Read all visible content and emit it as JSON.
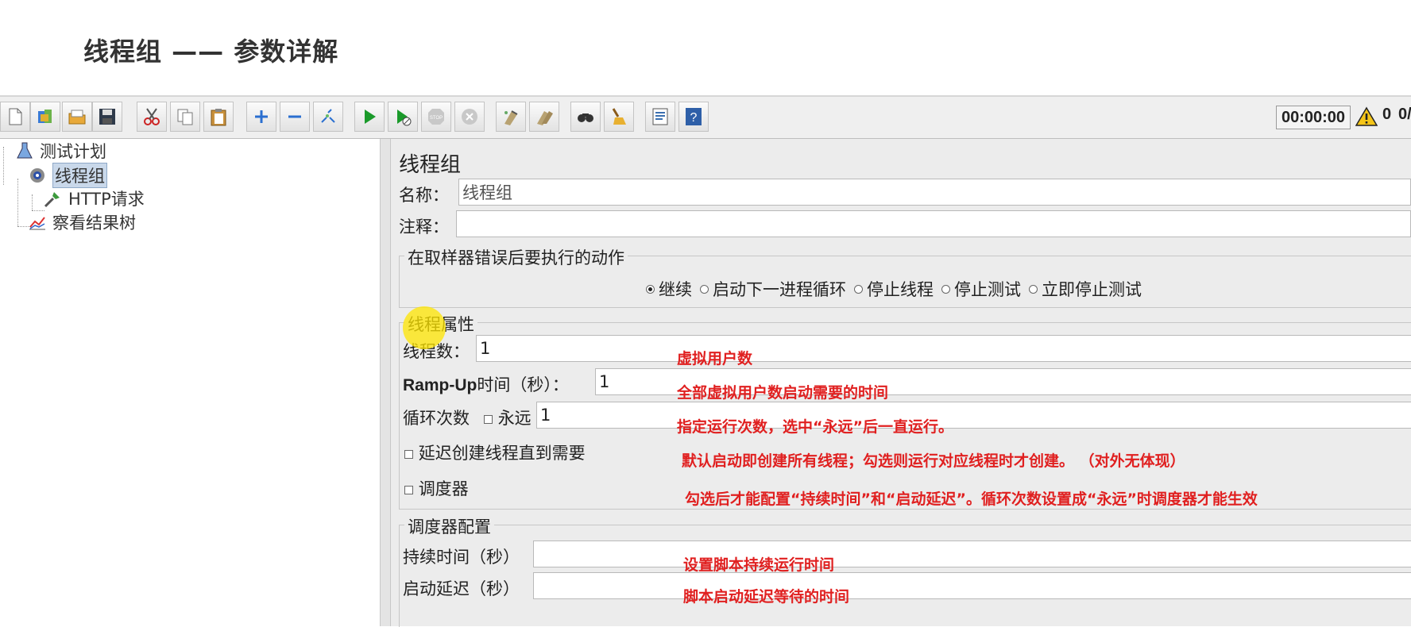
{
  "slide": {
    "title": "线程组 —— 参数详解"
  },
  "toolbar": {
    "buttons": [
      "new-icon",
      "templates-icon",
      "open-icon",
      "save-icon",
      "cut-icon",
      "copy-icon",
      "paste-icon",
      "expand-icon",
      "collapse-icon",
      "toggle-icon",
      "start-icon",
      "start-no-pause-icon",
      "stop-icon",
      "shutdown-icon",
      "clear-icon",
      "clear-all-icon",
      "search-icon",
      "reset-search-icon",
      "function-helper-icon",
      "help-icon"
    ],
    "timer": "00:00:00",
    "warning_count": "0",
    "running_count": "0/"
  },
  "tree": {
    "items": [
      {
        "label": "测试计划",
        "icon": "flask-icon"
      },
      {
        "label": "线程组",
        "icon": "gear-icon",
        "selected": true
      },
      {
        "label": "HTTP请求",
        "icon": "pipette-icon"
      },
      {
        "label": "察看结果树",
        "icon": "chart-icon"
      }
    ]
  },
  "panel": {
    "title": "线程组",
    "name_label": "名称：",
    "name_value": "线程组",
    "comment_label": "注释：",
    "comment_value": "",
    "error_group": {
      "title": "在取样器错误后要执行的动作",
      "options": [
        "继续",
        "启动下一进程循环",
        "停止线程",
        "停止测试",
        "立即停止测试"
      ],
      "selected": "继续"
    },
    "thread_group": {
      "title_part1": "线程",
      "title_part2": "属性",
      "threads_label": "线程数：",
      "threads_value": "1",
      "rampup_label_bold": "Ramp-Up",
      "rampup_label_rest": "时间（秒）：",
      "rampup_value": "1",
      "loop_label": "循环次数",
      "forever_label": "永远",
      "loop_value": "1",
      "delay_label": "延迟创建线程直到需要",
      "scheduler_label": "调度器"
    },
    "scheduler_group": {
      "title": "调度器配置",
      "duration_label": "持续时间（秒）",
      "duration_value": "",
      "delay_label": "启动延迟（秒）",
      "delay_value": ""
    }
  },
  "annotations": {
    "threads": "虚拟用户数",
    "rampup": "全部虚拟用户数启动需要的时间",
    "loop": "指定运行次数，选中“永远”后一直运行。",
    "delay": "默认启动即创建所有线程；勾选则运行对应线程时才创建。 （对外无体现）",
    "scheduler": "勾选后才能配置“持续时间”和“启动延迟”。循环次数设置成“永远”时调度器才能生效",
    "duration": "设置脚本持续运行时间",
    "startup_delay": "脚本启动延迟等待的时间"
  },
  "colors": {
    "annotation": "#e02020",
    "highlight": "#ffe600",
    "selection": "#c9d8ea"
  }
}
